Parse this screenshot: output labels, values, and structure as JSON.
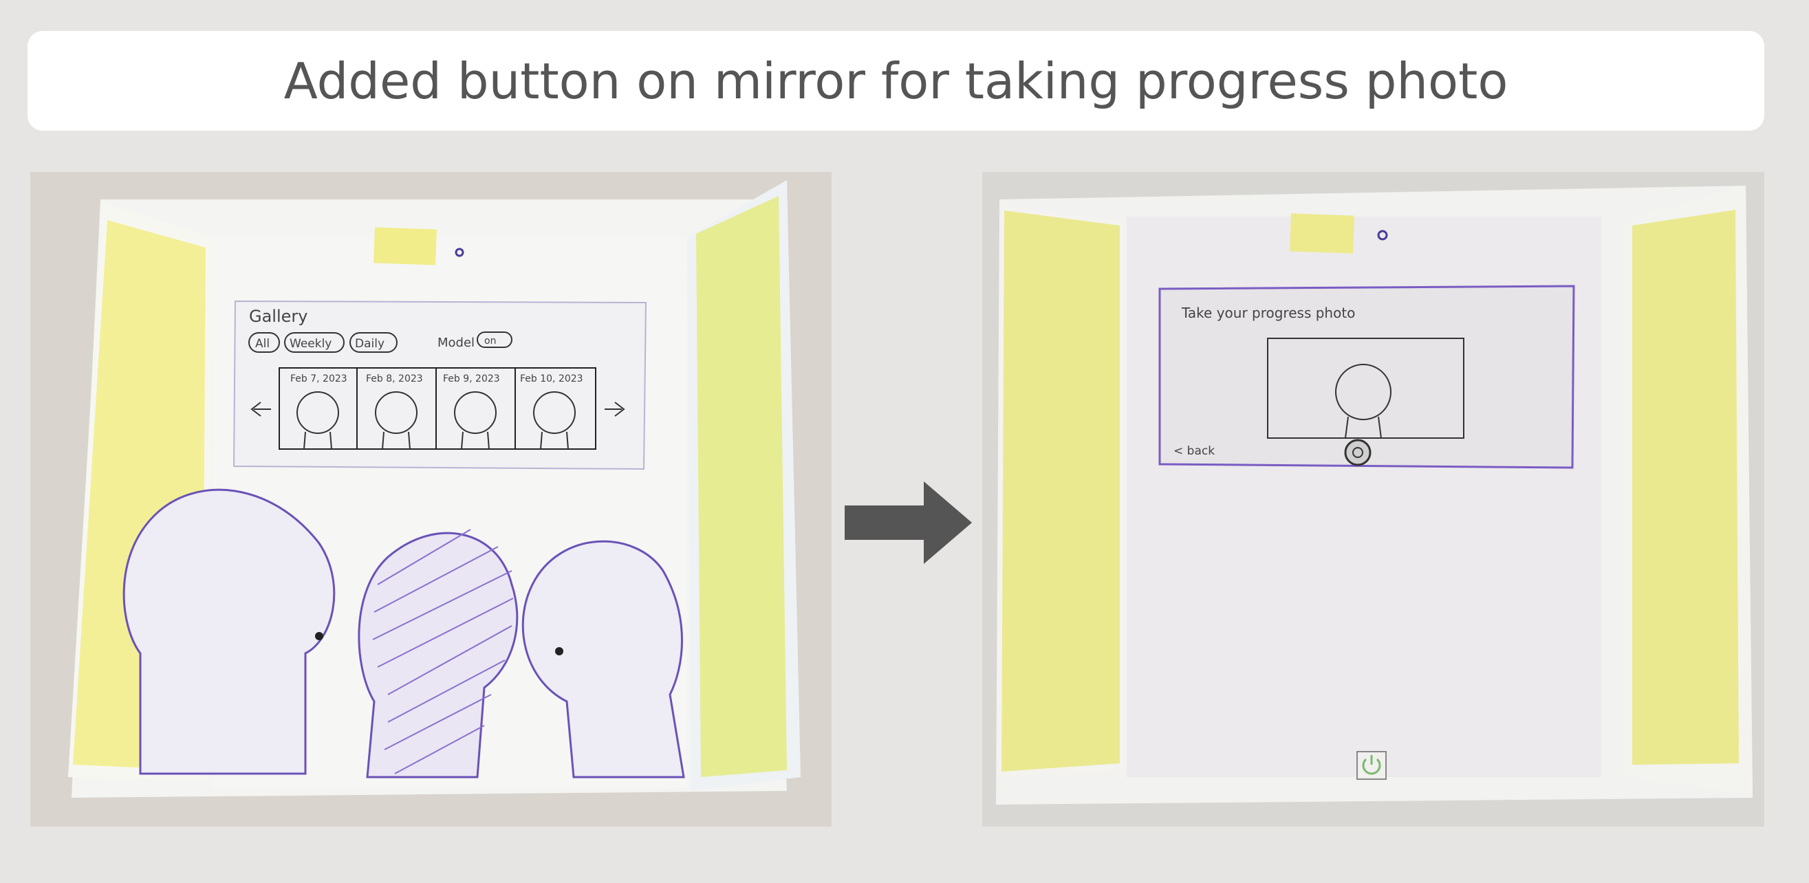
{
  "banner": {
    "title": "Added button on mirror for taking progress photo"
  },
  "before": {
    "gallery_title": "Gallery",
    "filters": [
      "All",
      "Weekly",
      "Daily"
    ],
    "model_label": "Model",
    "model_toggle": "on",
    "dates": [
      "Feb 7, 2023",
      "Feb 8, 2023",
      "Feb 9, 2023",
      "Feb 10, 2023"
    ]
  },
  "after": {
    "prompt": "Take your progress photo",
    "back_label": "< back"
  },
  "colors": {
    "sticky_yellow": "#f3ef96",
    "sticky_green": "#e6ec92",
    "ink_purple": "#7a5cc4",
    "arrow": "#555555"
  }
}
